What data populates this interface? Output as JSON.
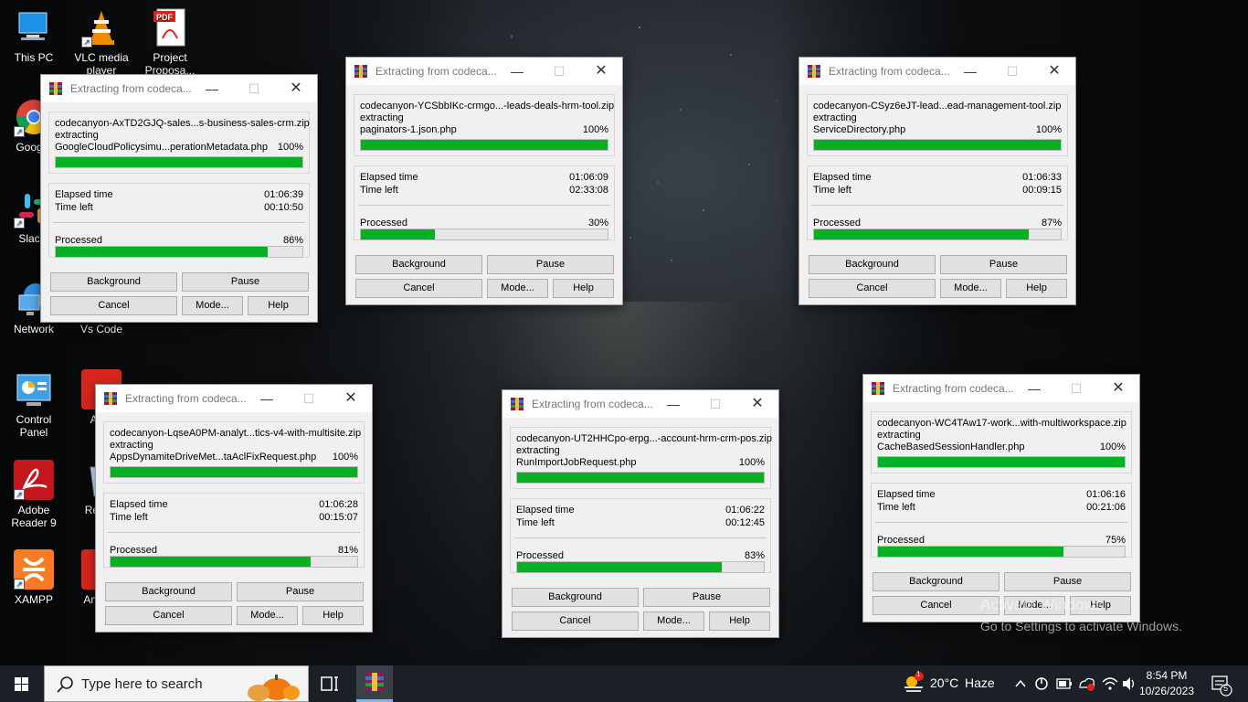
{
  "desktop_icons": [
    {
      "label": "This PC",
      "icon": "computer-icon"
    },
    {
      "label": "VLC media player",
      "icon": "vlc-icon"
    },
    {
      "label": "Project Proposa...",
      "icon": "pdf-icon"
    },
    {
      "label": "Goog...",
      "icon": "chrome-icon"
    },
    {
      "label": "Slac...",
      "icon": "slack-icon"
    },
    {
      "label": "Network",
      "icon": "network-icon"
    },
    {
      "label": "Vs Code",
      "icon": "vscode-icon"
    },
    {
      "label": "Control Panel",
      "icon": "control-panel-icon"
    },
    {
      "label": "An...",
      "icon": "anydesk-icon"
    },
    {
      "label": "Adobe Reader 9",
      "icon": "adobe-reader-icon"
    },
    {
      "label": "Recy...",
      "icon": "recycle-bin-icon"
    },
    {
      "label": "XAMPP",
      "icon": "xampp-icon"
    },
    {
      "label": "AnyD...",
      "icon": "anydesk-icon"
    }
  ],
  "dialog_common": {
    "title": "Extracting from codeca...",
    "extracting": "extracting",
    "elapsed_label": "Elapsed time",
    "left_label": "Time left",
    "processed_label": "Processed",
    "file_pct": "100%",
    "btn_background": "Background",
    "btn_pause": "Pause",
    "btn_cancel": "Cancel",
    "btn_mode": "Mode...",
    "btn_help": "Help"
  },
  "dialogs": [
    {
      "archive": "codecanyon-AxTD2GJQ-sales...s-business-sales-crm.zip",
      "file": "GoogleCloudPolicysimu...perationMetadata.php",
      "file_progress": 1.0,
      "elapsed": "01:06:39",
      "left": "00:10:50",
      "processed_pct": "86%",
      "processed": 0.86
    },
    {
      "archive": "codecanyon-YCSbbIKc-crmgo...-leads-deals-hrm-tool.zip",
      "file": "paginators-1.json.php",
      "file_progress": 1.0,
      "elapsed": "01:06:09",
      "left": "02:33:08",
      "processed_pct": "30%",
      "processed": 0.3
    },
    {
      "archive": "codecanyon-CSyz6eJT-lead...ead-management-tool.zip",
      "file": "ServiceDirectory.php",
      "file_progress": 1.0,
      "elapsed": "01:06:33",
      "left": "00:09:15",
      "processed_pct": "87%",
      "processed": 0.87
    },
    {
      "archive": "codecanyon-LqseA0PM-analyt...tics-v4-with-multisite.zip",
      "file": "AppsDynamiteDriveMet...taAclFixRequest.php",
      "file_progress": 1.0,
      "elapsed": "01:06:28",
      "left": "00:15:07",
      "processed_pct": "81%",
      "processed": 0.81
    },
    {
      "archive": "codecanyon-UT2HHCpo-erpg...-account-hrm-crm-pos.zip",
      "file": "RunImportJobRequest.php",
      "file_progress": 1.0,
      "elapsed": "01:06:22",
      "left": "00:12:45",
      "processed_pct": "83%",
      "processed": 0.83
    },
    {
      "archive": "codecanyon-WC4TAw17-work...with-multiworkspace.zip",
      "file": "CacheBasedSessionHandler.php",
      "file_progress": 1.0,
      "elapsed": "01:06:16",
      "left": "00:21:06",
      "processed_pct": "75%",
      "processed": 0.75
    }
  ],
  "watermark": {
    "line1": "Activate Windows",
    "line2": "Go to Settings to activate Windows."
  },
  "taskbar": {
    "search_placeholder": "Type here to search",
    "weather_temp": "20°C",
    "weather_text": "Haze",
    "weather_badge": "1",
    "time": "8:54 PM",
    "date": "10/26/2023",
    "notification_count": "5"
  }
}
